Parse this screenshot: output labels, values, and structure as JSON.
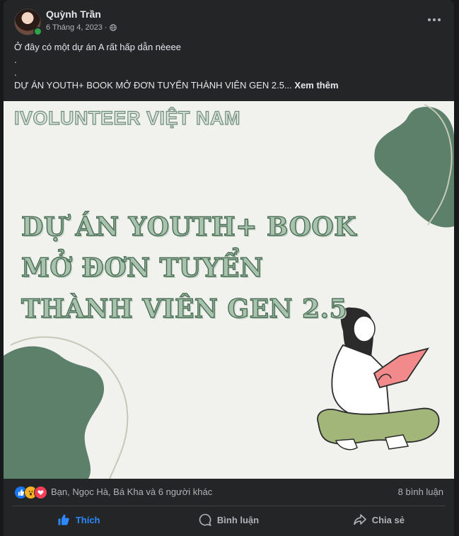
{
  "post": {
    "author": "Quỳnh Trần",
    "date": "6 Tháng 4, 2023",
    "date_separator": "·",
    "privacy_icon": "globe-icon",
    "text_lines": [
      "Ở đây có một dự án A rất hấp dẫn nèeee",
      ".",
      "."
    ],
    "text_last_line": "DỰ ÁN YOUTH+ BOOK MỞ ĐƠN TUYỂN THÀNH VIÊN GEN 2.5...",
    "see_more": "Xem thêm"
  },
  "image": {
    "org_name": "IVOLUNTEER VIỆT NAM",
    "title_lines": [
      "DỰ ÁN YOUTH+ BOOK",
      "MỞ ĐƠN TUYỂN",
      "THÀNH VIÊN GEN 2.5"
    ]
  },
  "reactions": {
    "icons": [
      "like-icon",
      "wow-icon",
      "love-icon"
    ],
    "summary": "Bạn, Ngọc Hà, Bá Kha và 6 người khác",
    "comments": "8 bình luận"
  },
  "actions": {
    "like": "Thích",
    "comment": "Bình luận",
    "share": "Chia sẻ"
  },
  "colors": {
    "background": "#18191a",
    "card": "#242526",
    "liked": "#2d88ff",
    "leaf_green": "#5d806a",
    "image_bg": "#f1f1ee"
  }
}
